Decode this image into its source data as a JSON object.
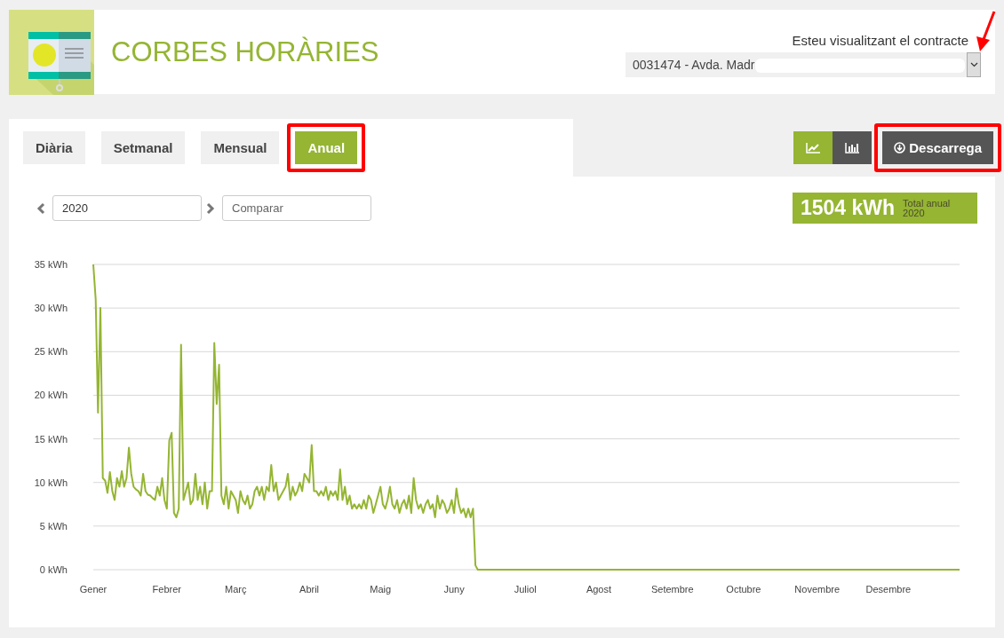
{
  "header": {
    "title": "CORBES HORÀRIES",
    "contract_label": "Esteu visualitzant el contracte",
    "contract_value": "0031474 - Avda. Madr"
  },
  "tabs": [
    {
      "label": "Diària",
      "selected": false,
      "highlighted": false
    },
    {
      "label": "Setmanal",
      "selected": false,
      "highlighted": false
    },
    {
      "label": "Mensual",
      "selected": false,
      "highlighted": false
    },
    {
      "label": "Anual",
      "selected": true,
      "highlighted": true
    }
  ],
  "view_toggle": [
    {
      "kind": "line",
      "selected": true
    },
    {
      "kind": "bar",
      "selected": false
    }
  ],
  "download": {
    "label": "Descarrega",
    "highlighted": true
  },
  "period": {
    "value": "2020",
    "compare_placeholder": "Comparar"
  },
  "total": {
    "value": "1504 kWh",
    "label": "Total anual",
    "year": "2020"
  },
  "chart": {
    "chart_data": {
      "type": "line",
      "grid": true,
      "ylim": [
        0,
        35
      ],
      "yticks": [
        {
          "value": 0,
          "label": "0 kWh"
        },
        {
          "value": 5,
          "label": "5 kWh"
        },
        {
          "value": 10,
          "label": "10 kWh"
        },
        {
          "value": 15,
          "label": "15 kWh"
        },
        {
          "value": 20,
          "label": "20 kWh"
        },
        {
          "value": 25,
          "label": "25 kWh"
        },
        {
          "value": 30,
          "label": "30 kWh"
        },
        {
          "value": 35,
          "label": "35 kWh"
        }
      ],
      "categories": [
        "Gener",
        null,
        null,
        null,
        null,
        null,
        null,
        null,
        null,
        null,
        null,
        null,
        null,
        null,
        null,
        null,
        null,
        null,
        null,
        null,
        null,
        null,
        null,
        null,
        null,
        null,
        null,
        null,
        null,
        null,
        null,
        "Febrer",
        null,
        null,
        null,
        null,
        null,
        null,
        null,
        null,
        null,
        null,
        null,
        null,
        null,
        null,
        null,
        null,
        null,
        null,
        null,
        null,
        null,
        null,
        null,
        null,
        null,
        null,
        null,
        null,
        "Març",
        null,
        null,
        null,
        null,
        null,
        null,
        null,
        null,
        null,
        null,
        null,
        null,
        null,
        null,
        null,
        null,
        null,
        null,
        null,
        null,
        null,
        null,
        null,
        null,
        null,
        null,
        null,
        null,
        null,
        null,
        "Abril",
        null,
        null,
        null,
        null,
        null,
        null,
        null,
        null,
        null,
        null,
        null,
        null,
        null,
        null,
        null,
        null,
        null,
        null,
        null,
        null,
        null,
        null,
        null,
        null,
        null,
        null,
        null,
        null,
        null,
        "Maig",
        null,
        null,
        null,
        null,
        null,
        null,
        null,
        null,
        null,
        null,
        null,
        null,
        null,
        null,
        null,
        null,
        null,
        null,
        null,
        null,
        null,
        null,
        null,
        null,
        null,
        null,
        null,
        null,
        null,
        null,
        "Juny",
        null,
        null,
        null,
        null,
        null,
        null,
        null,
        null,
        null,
        null,
        null,
        null,
        null,
        null,
        null,
        null,
        null,
        null,
        null,
        null,
        null,
        null,
        null,
        null,
        null,
        null,
        null,
        null,
        null,
        "Juliol",
        null,
        null,
        null,
        null,
        null,
        null,
        null,
        null,
        null,
        null,
        null,
        null,
        null,
        null,
        null,
        null,
        null,
        null,
        null,
        null,
        null,
        null,
        null,
        null,
        null,
        null,
        null,
        null,
        null,
        null,
        "Agost",
        null,
        null,
        null,
        null,
        null,
        null,
        null,
        null,
        null,
        null,
        null,
        null,
        null,
        null,
        null,
        null,
        null,
        null,
        null,
        null,
        null,
        null,
        null,
        null,
        null,
        null,
        null,
        null,
        null,
        null,
        "Setembre",
        null,
        null,
        null,
        null,
        null,
        null,
        null,
        null,
        null,
        null,
        null,
        null,
        null,
        null,
        null,
        null,
        null,
        null,
        null,
        null,
        null,
        null,
        null,
        null,
        null,
        null,
        null,
        null,
        null,
        "Octubre",
        null,
        null,
        null,
        null,
        null,
        null,
        null,
        null,
        null,
        null,
        null,
        null,
        null,
        null,
        null,
        null,
        null,
        null,
        null,
        null,
        null,
        null,
        null,
        null,
        null,
        null,
        null,
        null,
        null,
        null,
        "Novembre",
        null,
        null,
        null,
        null,
        null,
        null,
        null,
        null,
        null,
        null,
        null,
        null,
        null,
        null,
        null,
        null,
        null,
        null,
        null,
        null,
        null,
        null,
        null,
        null,
        null,
        null,
        null,
        null,
        null,
        "Desembre",
        null,
        null,
        null,
        null,
        null,
        null,
        null,
        null,
        null,
        null,
        null,
        null,
        null,
        null,
        null,
        null,
        null,
        null,
        null,
        null,
        null,
        null,
        null,
        null,
        null,
        null,
        null,
        null,
        null,
        null
      ],
      "series": [
        {
          "color": "#95b533",
          "values": [
            35,
            31,
            18,
            30,
            10.5,
            10.2,
            8.8,
            11.2,
            9,
            8,
            10.5,
            9.5,
            11.3,
            9.5,
            10.5,
            14,
            11,
            9.5,
            9.2,
            9,
            8.5,
            11,
            9,
            8.6,
            8.5,
            8.2,
            8,
            9.5,
            8.5,
            10.5,
            8,
            7,
            14.8,
            15.7,
            6.5,
            6,
            7,
            25.8,
            8,
            9,
            10,
            7.5,
            8,
            11,
            8,
            9.5,
            7.5,
            10,
            7,
            9,
            9,
            26,
            19,
            23.5,
            8.5,
            7.5,
            9.5,
            7,
            9,
            8.5,
            8,
            6.5,
            9,
            8,
            7.5,
            8.5,
            7,
            7.5,
            9,
            9.5,
            8.5,
            9.5,
            8,
            9.5,
            9,
            12,
            9,
            10,
            8,
            8.5,
            9,
            9.5,
            11,
            8,
            9.5,
            8.5,
            9,
            10,
            9,
            11,
            10.5,
            10,
            14.3,
            9,
            9,
            8.5,
            9,
            8.5,
            9.5,
            8,
            9,
            8.5,
            9,
            8,
            11.5,
            8,
            9.5,
            7.5,
            8.5,
            7,
            7.5,
            7,
            7.5,
            7,
            8,
            7,
            8.5,
            8,
            6.5,
            7.5,
            8.5,
            9.5,
            7.5,
            7,
            8,
            9.5,
            7.5,
            7,
            8,
            6.5,
            7.5,
            8,
            7,
            8.5,
            6.5,
            10.5,
            8,
            7,
            7.5,
            6.5,
            7.5,
            8,
            7,
            7.5,
            6,
            8.5,
            7,
            8,
            7.5,
            6.5,
            7,
            8,
            6.5,
            9.3,
            7.5,
            6.5,
            7,
            6,
            7,
            6,
            7,
            0.5,
            0,
            0,
            0,
            0,
            0,
            0,
            0,
            0,
            0,
            0,
            0,
            0,
            0,
            0,
            0,
            0,
            0,
            0,
            0,
            0,
            0,
            0,
            0,
            0,
            0,
            0,
            0,
            0,
            0,
            0,
            0,
            0,
            0,
            0,
            0,
            0,
            0,
            0,
            0,
            0,
            0,
            0,
            0,
            0,
            0,
            0,
            0,
            0,
            0,
            0,
            0,
            0,
            0,
            0,
            0,
            0,
            0,
            0,
            0,
            0,
            0,
            0,
            0,
            0,
            0,
            0,
            0,
            0,
            0,
            0,
            0,
            0,
            0,
            0,
            0,
            0,
            0,
            0,
            0,
            0,
            0,
            0,
            0,
            0,
            0,
            0,
            0,
            0,
            0,
            0,
            0,
            0,
            0,
            0,
            0,
            0,
            0,
            0,
            0,
            0,
            0,
            0,
            0,
            0,
            0,
            0,
            0,
            0,
            0,
            0,
            0,
            0,
            0,
            0,
            0,
            0,
            0,
            0,
            0,
            0,
            0,
            0,
            0,
            0,
            0,
            0,
            0,
            0,
            0,
            0,
            0,
            0,
            0,
            0,
            0,
            0,
            0,
            0,
            0,
            0,
            0,
            0,
            0,
            0,
            0,
            0,
            0,
            0,
            0,
            0,
            0,
            0,
            0,
            0,
            0,
            0,
            0,
            0,
            0,
            0,
            0,
            0,
            0,
            0,
            0,
            0,
            0,
            0,
            0,
            0,
            0,
            0,
            0,
            0,
            0,
            0,
            0,
            0,
            0,
            0,
            0,
            0,
            0,
            0,
            0,
            0,
            0,
            0,
            0,
            0,
            0,
            0,
            0,
            0,
            0,
            0,
            0,
            0,
            0,
            0,
            0,
            0,
            0,
            0
          ]
        }
      ]
    }
  }
}
